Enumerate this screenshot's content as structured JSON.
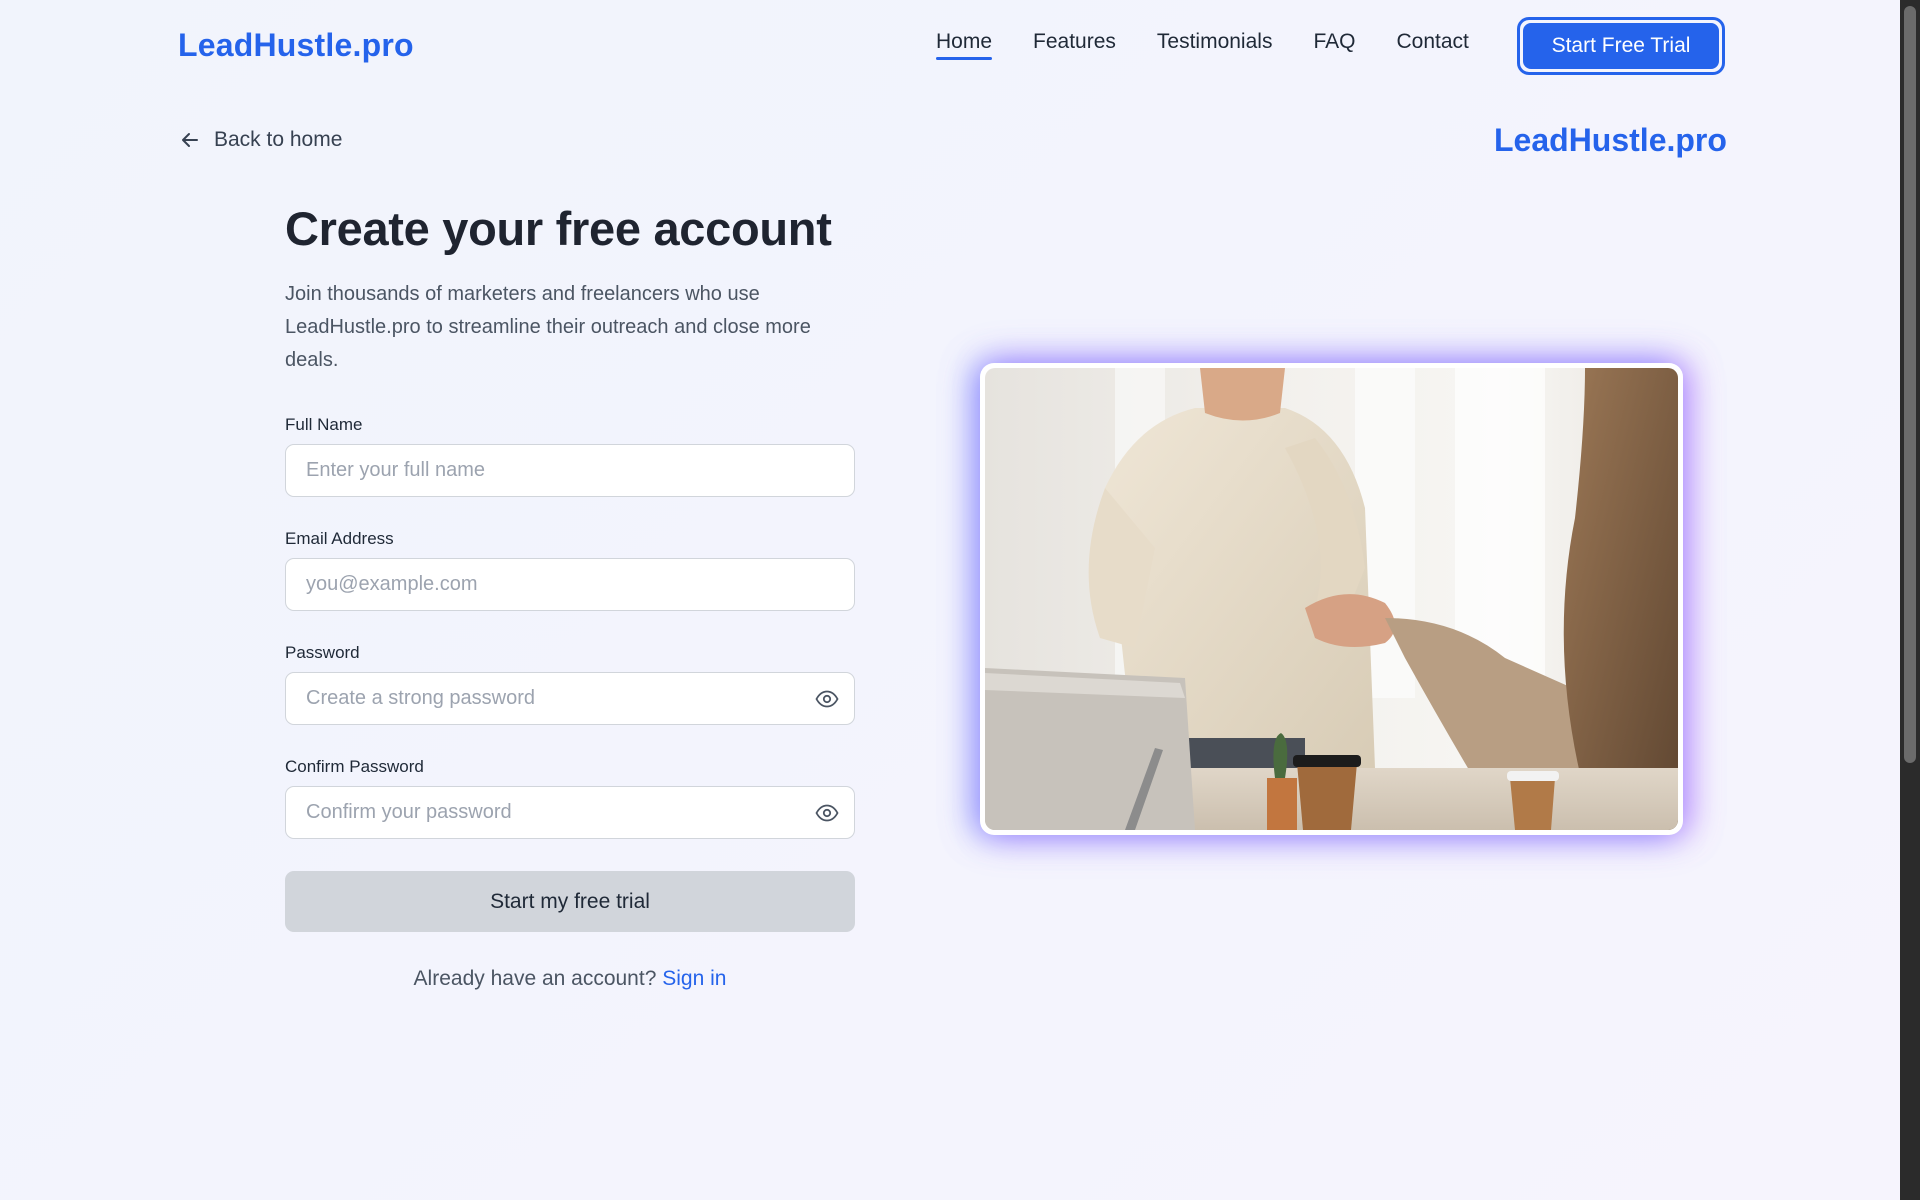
{
  "header": {
    "logo": "LeadHustle.pro",
    "nav": [
      {
        "label": "Home",
        "active": true
      },
      {
        "label": "Features",
        "active": false
      },
      {
        "label": "Testimonials",
        "active": false
      },
      {
        "label": "FAQ",
        "active": false
      },
      {
        "label": "Contact",
        "active": false
      }
    ],
    "cta_label": "Start Free Trial"
  },
  "back_link": {
    "label": "Back to home",
    "icon": "arrow-left-icon"
  },
  "brand_right": "LeadHustle.pro",
  "form": {
    "title": "Create your free account",
    "subtitle": "Join thousands of marketers and freelancers who use LeadHustle.pro to streamline their outreach and close more deals.",
    "fields": {
      "full_name": {
        "label": "Full Name",
        "placeholder": "Enter your full name",
        "value": ""
      },
      "email": {
        "label": "Email Address",
        "placeholder": "you@example.com",
        "value": ""
      },
      "password": {
        "label": "Password",
        "placeholder": "Create a strong password",
        "value": "",
        "icon": "eye-icon"
      },
      "confirm_password": {
        "label": "Confirm Password",
        "placeholder": "Confirm your password",
        "value": "",
        "icon": "eye-icon"
      }
    },
    "submit_label": "Start my free trial",
    "signin_prompt": "Already have an account?",
    "signin_link": "Sign in"
  },
  "colors": {
    "accent": "#2563eb",
    "submit_disabled": "#d1d5db",
    "glow_left": "#6078ff",
    "glow_right": "#be6eff"
  }
}
